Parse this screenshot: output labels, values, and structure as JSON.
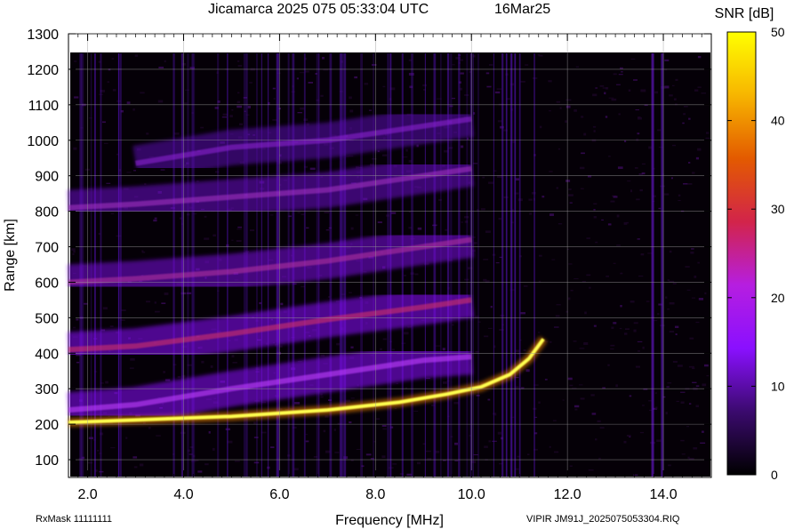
{
  "chart_data": {
    "type": "heatmap",
    "title_left": "Jicamarca 2025 075 05:33:04 UTC",
    "title_right": "16Mar25",
    "xlabel": "Frequency [MHz]",
    "ylabel": "Range [km]",
    "x_ticks": [
      "2.0",
      "4.0",
      "6.0",
      "8.0",
      "10.0",
      "12.0",
      "14.0"
    ],
    "x_tick_values": [
      2,
      4,
      6,
      8,
      10,
      12,
      14
    ],
    "y_ticks": [
      "100",
      "200",
      "300",
      "400",
      "500",
      "600",
      "700",
      "800",
      "900",
      "1000",
      "1100",
      "1200",
      "1300"
    ],
    "y_tick_values": [
      100,
      200,
      300,
      400,
      500,
      600,
      700,
      800,
      900,
      1000,
      1100,
      1200,
      1300
    ],
    "xlim": [
      1.6,
      15.0
    ],
    "ylim": [
      50,
      1300
    ],
    "grid": true,
    "colorbar": {
      "label": "SNR [dB]",
      "ticks": [
        "0",
        "10",
        "20",
        "30",
        "40",
        "50"
      ],
      "tick_values": [
        0,
        10,
        20,
        30,
        40,
        50
      ],
      "range": [
        0,
        50
      ],
      "colors": [
        "#000000",
        "#3b0a6e",
        "#8a10ff",
        "#b61ee0",
        "#d2244a",
        "#e35a00",
        "#f7b500",
        "#ffff00"
      ]
    },
    "series": [
      {
        "values": [
          [
            1.6,
            205
          ],
          [
            3,
            212
          ],
          [
            5,
            222
          ],
          [
            7,
            240
          ],
          [
            8.5,
            262
          ],
          [
            9.5,
            285
          ],
          [
            10.2,
            305
          ],
          [
            10.8,
            340
          ],
          [
            11.2,
            385
          ],
          [
            11.5,
            440
          ]
        ]
      },
      {
        "values": [
          [
            1.6,
            240
          ],
          [
            3,
            255
          ],
          [
            5,
            300
          ],
          [
            7,
            340
          ],
          [
            9,
            380
          ],
          [
            10,
            390
          ]
        ]
      },
      {
        "values": [
          [
            1.6,
            410
          ],
          [
            3,
            420
          ],
          [
            5,
            455
          ],
          [
            7,
            495
          ],
          [
            9,
            530
          ],
          [
            10,
            550
          ]
        ]
      },
      {
        "values": [
          [
            1.6,
            600
          ],
          [
            3,
            610
          ],
          [
            5,
            630
          ],
          [
            7,
            660
          ],
          [
            9,
            700
          ],
          [
            10,
            720
          ]
        ]
      },
      {
        "values": [
          [
            1.6,
            810
          ],
          [
            3,
            820
          ],
          [
            5,
            840
          ],
          [
            7,
            860
          ],
          [
            9,
            900
          ],
          [
            10,
            920
          ]
        ]
      },
      {
        "values": [
          [
            3,
            935
          ],
          [
            5,
            980
          ],
          [
            7,
            1000
          ],
          [
            9,
            1040
          ],
          [
            10,
            1060
          ]
        ]
      }
    ],
    "bottom_left_label": "RxMask 11111111",
    "bottom_right_label": "VIPIR  JM91J_2025075053304.RIQ"
  }
}
